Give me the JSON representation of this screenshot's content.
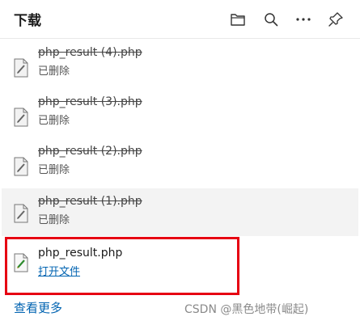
{
  "header": {
    "title": "下载",
    "icons": [
      "folder-icon",
      "search-icon",
      "more-icon",
      "pin-icon"
    ]
  },
  "downloads": [
    {
      "filename": "php_result (4).php",
      "status": "已删除",
      "deleted": true
    },
    {
      "filename": "php_result (3).php",
      "status": "已删除",
      "deleted": true
    },
    {
      "filename": "php_result (2).php",
      "status": "已删除",
      "deleted": true
    },
    {
      "filename": "php_result (1).php",
      "status": "已删除",
      "deleted": true
    },
    {
      "filename": "php_result.php",
      "action": "打开文件",
      "deleted": false
    }
  ],
  "footer": {
    "see_more": "查看更多"
  },
  "watermark": "CSDN @黑色地带(崛起)",
  "colors": {
    "link": "#0063b1",
    "highlight": "#e60012",
    "hover_row": "#f3f3f3"
  }
}
